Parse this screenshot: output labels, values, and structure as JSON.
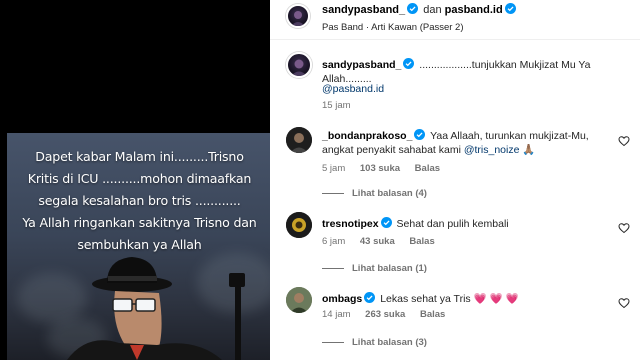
{
  "media": {
    "caption": "Dapet kabar Malam ini.........Trisno\nKritis di ICU ..........mohon dimaafkan\nsegala kesalahan bro tris ............\nYa Allah ringankan sakitnya Trisno dan\nsembuhkan ya Allah"
  },
  "header": {
    "user": "sandypasband_",
    "and_text": "dan",
    "coauthor": "pasband.id",
    "subtitle": "Pas Band · Arti Kawan (Passer 2)"
  },
  "caption_comment": {
    "user": "sandypasband_",
    "text": "..................tunjukkan Mukjizat Mu Ya Allah.........",
    "mention": "@pasband.id",
    "time": "15 jam"
  },
  "comments": [
    {
      "user": "_bondanprakoso_",
      "text": "Yaa Allaah, turunkan mukjizat-Mu, angkat penyakit sahabat kami",
      "mention": "@tris_noize",
      "emoji": "🙏🏽",
      "time": "5 jam",
      "likes": "103 suka",
      "reply": "Balas",
      "view_replies": "Lihat balasan (4)"
    },
    {
      "user": "tresnotipex",
      "text": "Sehat dan pulih kembali",
      "time": "6 jam",
      "likes": "43 suka",
      "reply": "Balas",
      "view_replies": "Lihat balasan (1)"
    },
    {
      "user": "ombags",
      "text": "Lekas sehat ya Tris",
      "emoji": "💗 💗 💗",
      "time": "14 jam",
      "likes": "263 suka",
      "reply": "Balas",
      "view_replies": "Lihat balasan (3)"
    }
  ],
  "colors": {
    "verified": "#0095f6",
    "mention": "#00376b",
    "muted": "#737373"
  }
}
